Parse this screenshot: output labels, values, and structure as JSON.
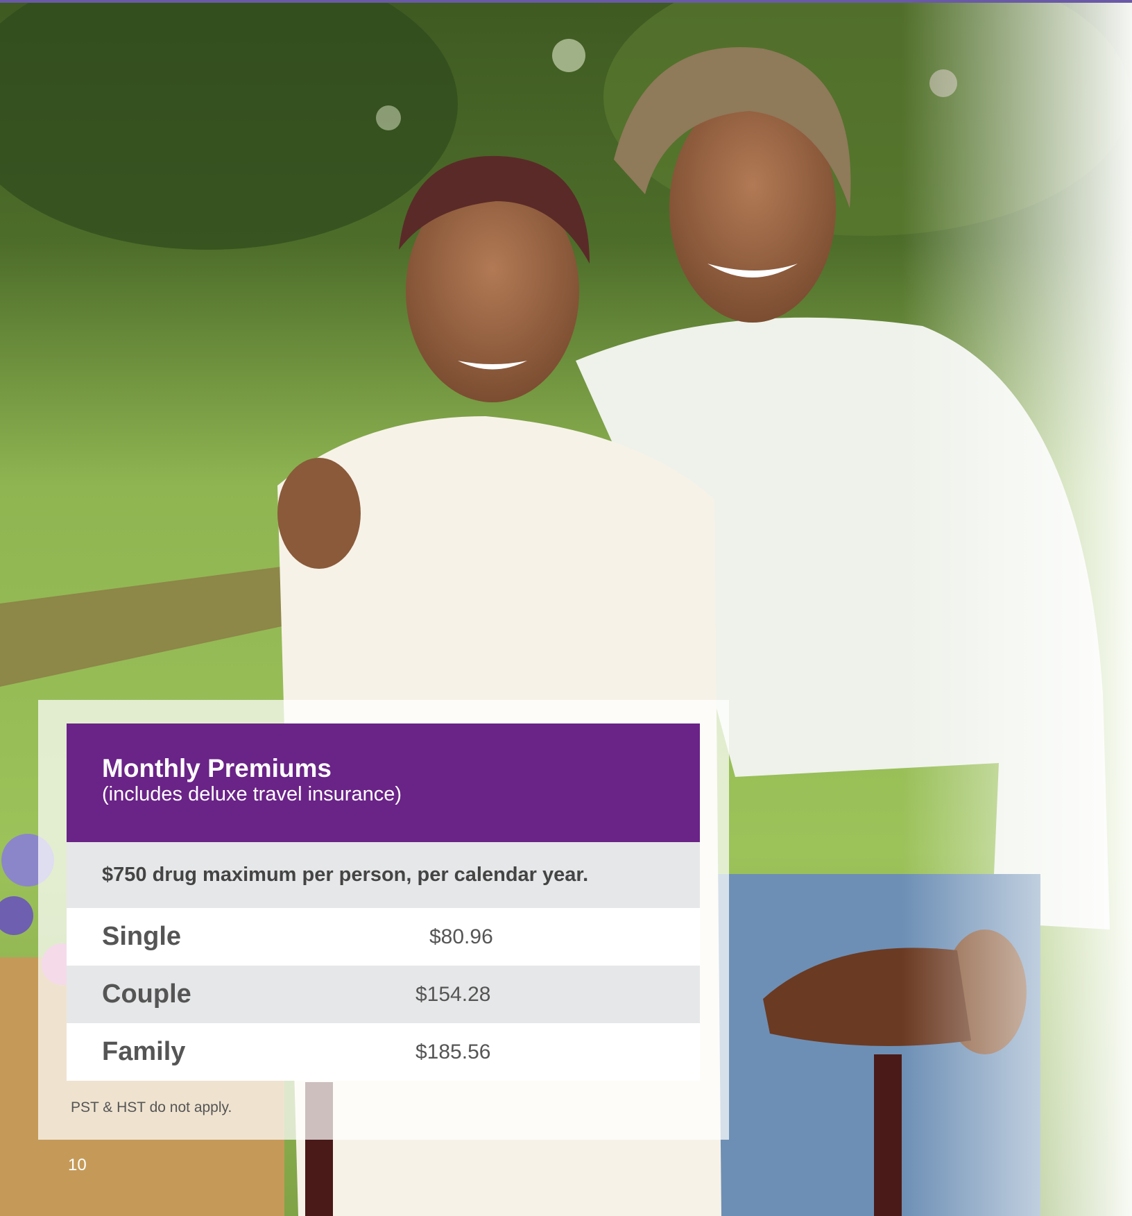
{
  "card": {
    "title": "Monthly Premiums",
    "subtitle": "(includes deluxe travel insurance)",
    "note": "$750 drug maximum per person, per calendar year.",
    "rows": [
      {
        "label": "Single",
        "value": "$80.96"
      },
      {
        "label": "Couple",
        "value": "$154.28"
      },
      {
        "label": "Family",
        "value": "$185.56"
      }
    ]
  },
  "footnote": "PST & HST do not apply.",
  "page_number": "10",
  "colors": {
    "header": "#6a2387",
    "note_row": "#e6e7e8",
    "top_line": "#6a5aa6"
  }
}
